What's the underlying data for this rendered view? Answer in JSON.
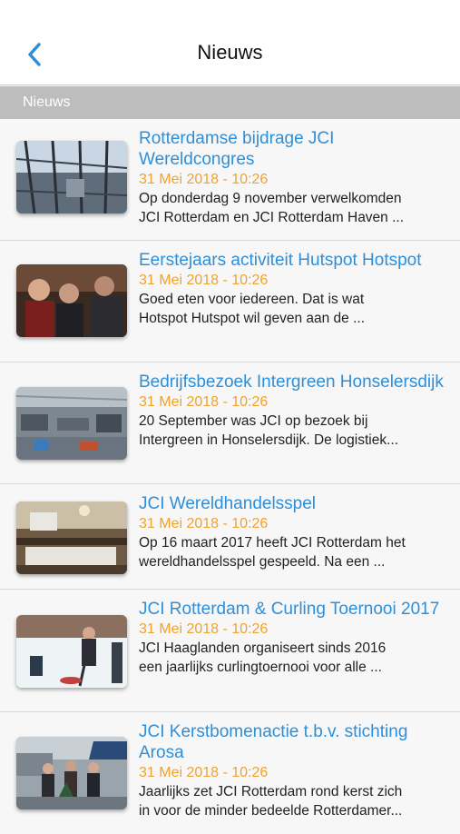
{
  "header": {
    "title": "Nieuws",
    "back_icon": "chevron-left-icon",
    "accent_color": "#2e8fd8"
  },
  "section": {
    "label": "Nieuws"
  },
  "colors": {
    "title": "#2e8fd8",
    "date": "#f0a22e",
    "section_bg": "#bdbdbd"
  },
  "news": [
    {
      "title": "Rotterdamse bijdrage JCI Wereldcongres",
      "date": "31 Mei 2018 - 10:26",
      "desc": "Op donderdag 9 november verwelkomden\nJCI Rotterdam en JCI Rotterdam Haven ..."
    },
    {
      "title": "Eerstejaars activiteit Hutspot Hotspot",
      "date": "31 Mei 2018 - 10:26",
      "desc": "Goed eten voor iedereen. Dat is wat\nHotspot Hutspot wil geven aan de ..."
    },
    {
      "title": "Bedrijfsbezoek Intergreen Honselersdijk",
      "date": "31 Mei 2018 - 10:26",
      "desc": "20 September was JCI op bezoek bij\nIntergreen in Honselersdijk. De logistiek..."
    },
    {
      "title": "JCI Wereldhandelsspel",
      "date": "31 Mei 2018 - 10:26",
      "desc": "Op 16 maart 2017 heeft JCI Rotterdam het\nwereldhandelsspel gespeeld. Na een ..."
    },
    {
      "title": "JCI Rotterdam & Curling Toernooi 2017",
      "date": "31 Mei 2018 - 10:26",
      "desc": "JCI Haaglanden organiseert sinds 2016\neen jaarlijks curlingtoernooi voor alle ..."
    },
    {
      "title": "JCI Kerstbomenactie t.b.v. stichting Arosa",
      "date": "31 Mei 2018 - 10:26",
      "desc": "Jaarlijks zet JCI Rotterdam rond kerst zich\nin voor de minder bedeelde Rotterdamer..."
    }
  ]
}
